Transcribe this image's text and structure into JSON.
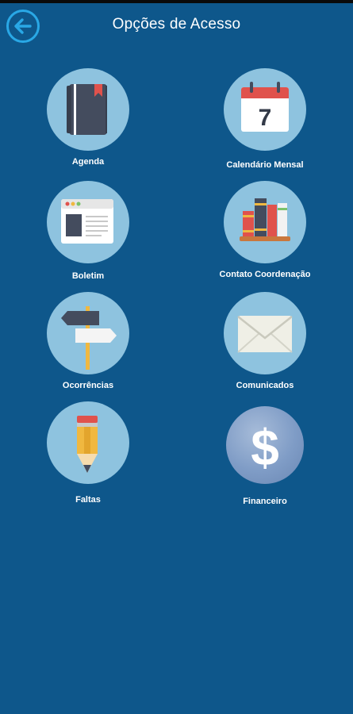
{
  "header": {
    "title": "Opções de Acesso",
    "back_icon": "arrow-left-icon"
  },
  "colors": {
    "background": "#0e578b",
    "icon_circle": "#8ec3df",
    "back_accent": "#29a8e6"
  },
  "menu": {
    "items": [
      {
        "label": "Agenda",
        "icon": "notebook-icon"
      },
      {
        "label": "Calendário Mensal",
        "icon": "calendar-icon",
        "icon_text": "7"
      },
      {
        "label": "Boletim",
        "icon": "browser-window-icon"
      },
      {
        "label": "Contato Coordenação",
        "icon": "books-icon"
      },
      {
        "label": "Ocorrências",
        "icon": "signpost-icon"
      },
      {
        "label": "Comunicados",
        "icon": "envelope-icon"
      },
      {
        "label": "Faltas",
        "icon": "pencil-icon"
      },
      {
        "label": "Financeiro",
        "icon": "dollar-icon",
        "icon_text": "$"
      }
    ]
  }
}
